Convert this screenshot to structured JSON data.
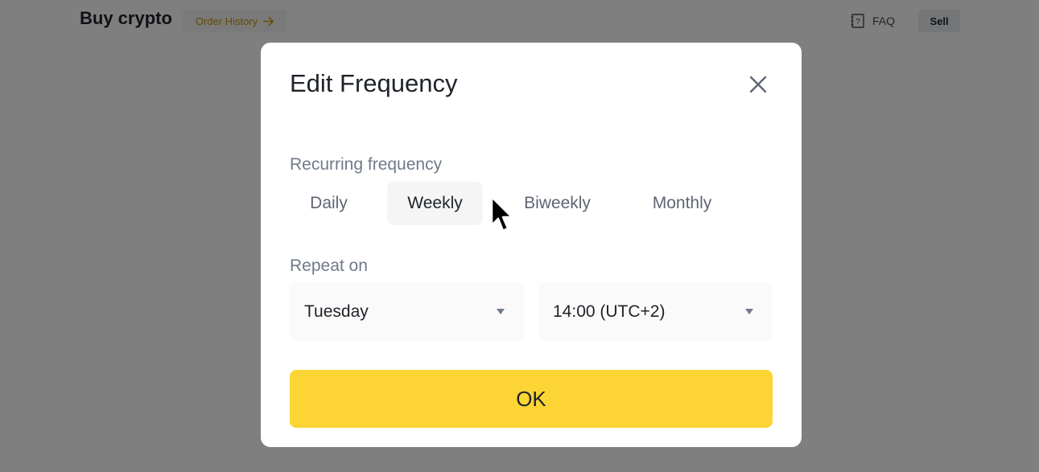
{
  "header": {
    "title": "Buy crypto",
    "order_history_label": "Order History",
    "faq_label": "FAQ",
    "sell_label": "Sell"
  },
  "modal": {
    "title": "Edit Frequency",
    "recurring_label": "Recurring frequency",
    "frequency_options": [
      "Daily",
      "Weekly",
      "Biweekly",
      "Monthly"
    ],
    "selected_frequency": "Weekly",
    "repeat_label": "Repeat on",
    "day_value": "Tuesday",
    "time_value": "14:00 (UTC+2)",
    "ok_label": "OK"
  },
  "colors": {
    "accent": "#fcd535",
    "order_history_text": "#c99400",
    "overlay": "rgba(0,0,0,0.5)"
  },
  "icons": {
    "order_history": "arrow-right-icon",
    "faq": "faq-icon",
    "close": "close-icon",
    "dropdown": "caret-down-icon",
    "cursor": "mouse-pointer-icon"
  }
}
